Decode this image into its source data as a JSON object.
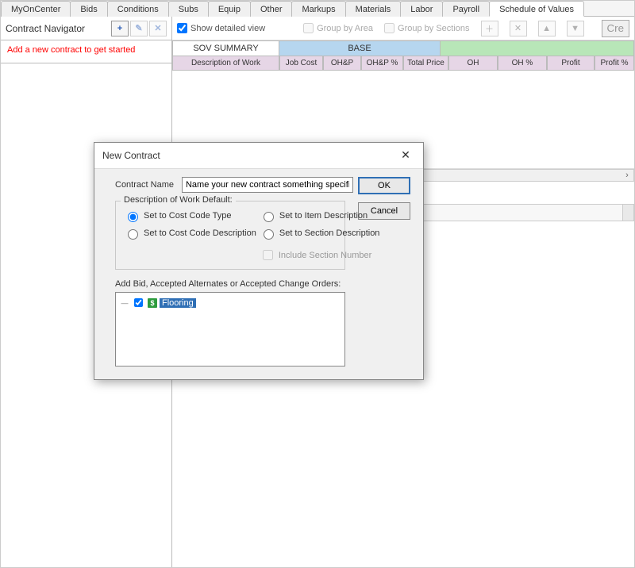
{
  "tabs": [
    "MyOnCenter",
    "Bids",
    "Conditions",
    "Subs",
    "Equip",
    "Other",
    "Markups",
    "Materials",
    "Labor",
    "Payroll",
    "Schedule of Values"
  ],
  "active_tab_index": 10,
  "sidebar": {
    "title": "Contract Navigator",
    "empty_message": "Add a new contract to get started",
    "buttons": {
      "add": "+",
      "edit": "✎",
      "delete": "✕"
    }
  },
  "toolbar": {
    "show_detailed": "Show detailed view",
    "group_area": "Group by Area",
    "group_sections": "Group by Sections",
    "create": "Cre"
  },
  "grid": {
    "group_headers": {
      "sov": "SOV SUMMARY",
      "base": "BASE"
    },
    "columns": [
      "Description of Work",
      "Job Cost",
      "OH&P",
      "OH&P %",
      "Total Price",
      "OH",
      "OH %",
      "Profit",
      "Profit %"
    ]
  },
  "dialog": {
    "title": "New Contract",
    "contract_name_label": "Contract Name",
    "contract_name_value": "Name your new contract something specific",
    "ok": "OK",
    "cancel": "Cancel",
    "group_legend": "Description of Work Default:",
    "radios": {
      "cost_code_type": "Set to Cost Code Type",
      "item_description": "Set to Item Description",
      "cost_code_desc": "Set to Cost Code Description",
      "section_desc": "Set to Section Description"
    },
    "include_section": "Include Section Number",
    "add_label": "Add Bid, Accepted Alternates or Accepted Change Orders:",
    "tree_item": "Flooring",
    "tree_icon": "$"
  }
}
